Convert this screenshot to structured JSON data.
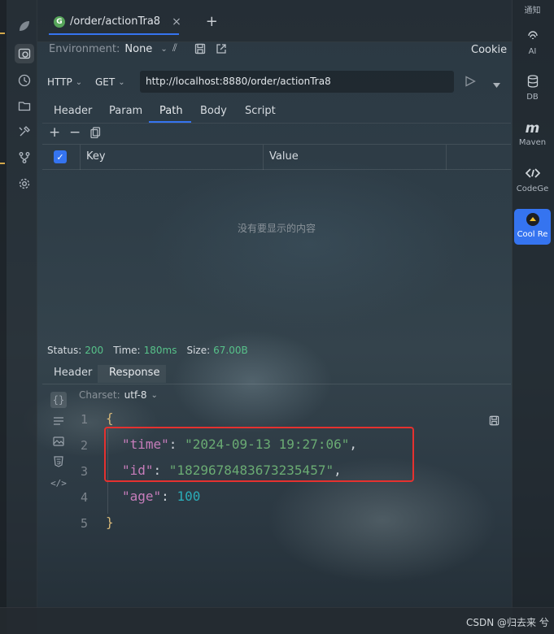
{
  "tab": {
    "icon_letter": "G",
    "title": "/order/actionTra8",
    "close": "×",
    "new": "+"
  },
  "toolbar": {
    "env_label": "Environment:",
    "env_value": "None",
    "cookie": "Cookie"
  },
  "request": {
    "protocol": "HTTP",
    "method": "GET",
    "url": "http://localhost:8880/order/actionTra8"
  },
  "req_tabs": [
    "Header",
    "Param",
    "Path",
    "Body",
    "Script"
  ],
  "req_active": "Path",
  "table": {
    "add": "+",
    "remove": "−",
    "col_key": "Key",
    "col_value": "Value",
    "empty": "没有要显示的内容"
  },
  "status": {
    "status_label": "Status:",
    "status_value": "200",
    "time_label": "Time:",
    "time_value": "180ms",
    "size_label": "Size:",
    "size_value": "67.00B"
  },
  "resp_tabs": [
    "Header",
    "Response"
  ],
  "resp_active": "Response",
  "charset": {
    "label": "Charset:",
    "value": "utf-8"
  },
  "code": {
    "line_numbers": [
      "1",
      "2",
      "3",
      "4",
      "5"
    ],
    "open": "{",
    "close": "}",
    "lines": [
      {
        "key": "\"time\"",
        "sep": ": ",
        "value": "\"2024-09-13 19:27:06\"",
        "comma": ","
      },
      {
        "key": "\"id\"",
        "sep": ": ",
        "value": "\"1829678483673235457\"",
        "comma": ","
      },
      {
        "key": "\"age\"",
        "sep": ": ",
        "value": "100",
        "comma": ""
      }
    ]
  },
  "right_panel": {
    "notify": "通知",
    "ai": "AI",
    "db": "DB",
    "maven": "Maven",
    "codegee": "CodeGe",
    "coolre": "Cool Re"
  },
  "watermark": "CSDN @归去来 兮",
  "colors": {
    "accent": "#3574f0",
    "status_ok": "#57c28a",
    "highlight_box": "#e5312f"
  }
}
